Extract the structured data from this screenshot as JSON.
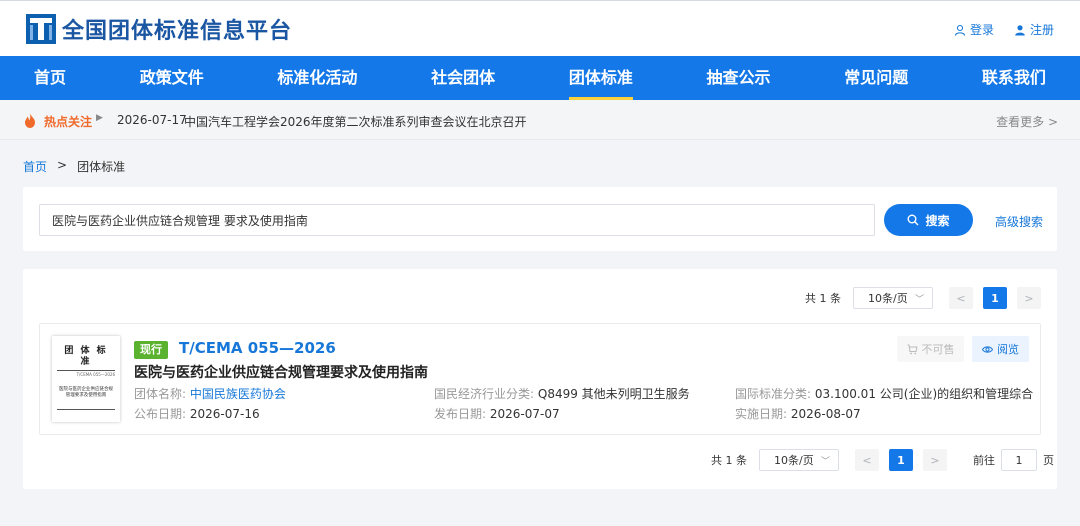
{
  "header": {
    "site_title": "全国团体标准信息平台",
    "login": "登录",
    "register": "注册"
  },
  "nav": {
    "items": [
      "首页",
      "政策文件",
      "标准化活动",
      "社会团体",
      "团体标准",
      "抽查公示",
      "常见问题",
      "联系我们"
    ],
    "active": "团体标准"
  },
  "hot": {
    "label": "热点关注",
    "date": "2026-07-17",
    "title": "中国汽车工程学会2026年度第二次标准系列审查会议在北京召开",
    "more": "查看更多 >"
  },
  "breadcrumb": {
    "home": "首页",
    "separator": ">",
    "current": "团体标准"
  },
  "search": {
    "value": "医院与医药企业供应链合规管理 要求及使用指南",
    "button": "搜索",
    "advanced": "高级搜索"
  },
  "pagination": {
    "total": "共 1 条",
    "page_size": "10条/页",
    "prev": "<",
    "current_page": "1",
    "next": ">",
    "goto_label": "前往",
    "goto_value": "1",
    "goto_unit": "页"
  },
  "result": {
    "status": "现行",
    "code": "T/CEMA 055—2026",
    "title": "医院与医药企业供应链合规管理要求及使用指南",
    "org_label": "团体名称:",
    "org": "中国民族医药协会",
    "publish_label": "公布日期:",
    "publish_date": "2026-07-16",
    "industry_label": "国民经济行业分类:",
    "industry": "Q8499 其他未列明卫生服务",
    "release_label": "发布日期:",
    "release_date": "2026-07-07",
    "ics_label": "国际标准分类:",
    "ics": "03.100.01 公司(企业)的组织和管理综合",
    "impl_label": "实施日期:",
    "impl_date": "2026-08-07",
    "btn_unavailable": "不可售",
    "btn_read": "阅览",
    "thumb": {
      "head": "团 体 标 准",
      "code": "T/CEMA 055—2026",
      "title": "医院与医药企业供应链合规管理要求及使用指南"
    }
  },
  "colors": {
    "primary": "#1478e8",
    "nav_active_underline": "#ffd23c",
    "status_green": "#5ab22e",
    "hot_orange": "#f06a2b"
  }
}
